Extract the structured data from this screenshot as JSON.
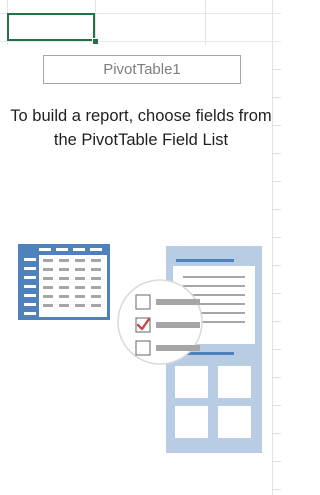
{
  "pivot_placeholder": {
    "name": "PivotTable1",
    "instructions": "To build a report, choose fields from the PivotTable Field List"
  },
  "colors": {
    "active_cell_border": "#217346",
    "grid_line": "#e3e3e3",
    "illustration_blue": "#4f81bd",
    "illustration_light_blue": "#b8cce4",
    "checkmark_red": "#c0504d"
  },
  "icons": {
    "illustration": "pivottable-field-list-illustration"
  }
}
